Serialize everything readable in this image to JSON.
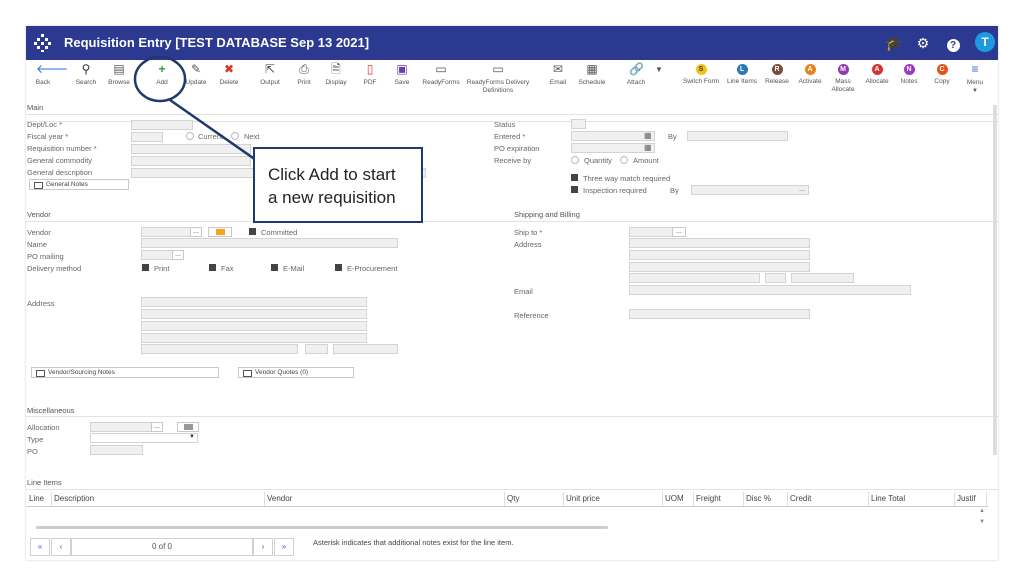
{
  "window": {
    "title": "Requisition Entry [TEST DATABASE Sep 13 2021]",
    "avatar_initial": "T"
  },
  "toolbar": {
    "back": "Back",
    "search": "Search",
    "browse": "Browse",
    "add": "Add",
    "update": "Update",
    "delete": "Delete",
    "output": "Output",
    "print": "Print",
    "display": "Display",
    "pdf": "PDF",
    "save": "Save",
    "readyforms": "ReadyForms",
    "readyforms_delivery": "ReadyForms Delivery",
    "definitions": "Definitions",
    "email": "Email",
    "schedule": "Schedule",
    "attach": "Attach",
    "switch_form": "Switch Form",
    "line_items": "Line Items",
    "release": "Release",
    "activate": "Activate",
    "mass": "Mass",
    "allocate_2": "Allocate",
    "allocate": "Allocate",
    "notes": "Notes",
    "copy": "Copy",
    "menu": "Menu",
    "switch_letter": "S",
    "line_letter": "L",
    "release_letter": "R",
    "activate_letter": "A",
    "mass_letter": "M",
    "allocate_letter": "A",
    "notes_letter": "N",
    "copy_letter": "C"
  },
  "main": {
    "section": "Main",
    "dept_loc": "Dept/Loc *",
    "fiscal_year": "Fiscal year *",
    "current": "Current",
    "next": "Next",
    "requisition_number": "Requisition number *",
    "general_commodity": "General commodity",
    "general_description": "General description",
    "general_notes": "General Notes",
    "status": "Status",
    "entered": "Entered *",
    "by": "By",
    "po_expiration": "PO expiration",
    "receive_by": "Receive by",
    "quantity": "Quantity",
    "amount": "Amount",
    "three_way": "Three way match required",
    "inspection": "Inspection required",
    "by2": "By",
    "ellipsis": "..."
  },
  "vendor": {
    "section": "Vendor",
    "vendor": "Vendor",
    "committed": "Committed",
    "name": "Name",
    "po_mailing": "PO mailing",
    "delivery_method": "Delivery method",
    "print": "Print",
    "fax": "Fax",
    "email": "E-Mail",
    "eprocurement": "E-Procurement",
    "address": "Address",
    "vendor_notes": "Vendor/Sourcing Notes",
    "vendor_quotes": "Vendor Quotes (0)"
  },
  "shipping": {
    "section": "Shipping and Billing",
    "ship_to": "Ship to *",
    "address": "Address",
    "email": "Email",
    "reference": "Reference"
  },
  "misc": {
    "section": "Miscellaneous",
    "allocation": "Allocation",
    "type": "Type",
    "po": "PO"
  },
  "line_items": {
    "section": "Line Items",
    "columns": [
      "Line",
      "Description",
      "Vendor",
      "Qty",
      "Unit price",
      "UOM",
      "Freight",
      "Disc %",
      "Credit",
      "Line Total",
      "Justif"
    ]
  },
  "pager": {
    "first": "«",
    "prev": "‹",
    "count": "0 of 0",
    "next": "›",
    "last": "»"
  },
  "footer_note": "Asterisk indicates that additional notes exist for the line item.",
  "callout": {
    "line1": "Click Add to start",
    "line2": "a new requisition"
  }
}
